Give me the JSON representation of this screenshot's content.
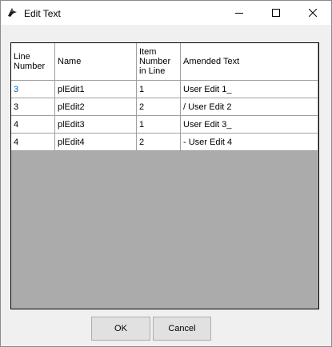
{
  "window": {
    "title": "Edit Text",
    "icon": "app-logo-icon"
  },
  "titlebar_buttons": {
    "minimize": "minimize-icon",
    "maximize": "maximize-icon",
    "close": "close-icon"
  },
  "grid": {
    "columns": [
      "Line Number",
      "Name",
      "Item Number in Line",
      "Amended Text"
    ],
    "rows": [
      {
        "line": "3",
        "name": "plEdit1",
        "item": "1",
        "text": "User Edit 1_"
      },
      {
        "line": "3",
        "name": "plEdit2",
        "item": "2",
        "text": "/ User Edit 2"
      },
      {
        "line": "4",
        "name": "plEdit3",
        "item": "1",
        "text": "User Edit 3_"
      },
      {
        "line": "4",
        "name": "plEdit4",
        "item": "2",
        "text": "- User Edit 4"
      }
    ]
  },
  "buttons": {
    "ok": "OK",
    "cancel": "Cancel"
  },
  "colors": {
    "selected_text": "#0066cc",
    "grid_background": "#ababab"
  }
}
